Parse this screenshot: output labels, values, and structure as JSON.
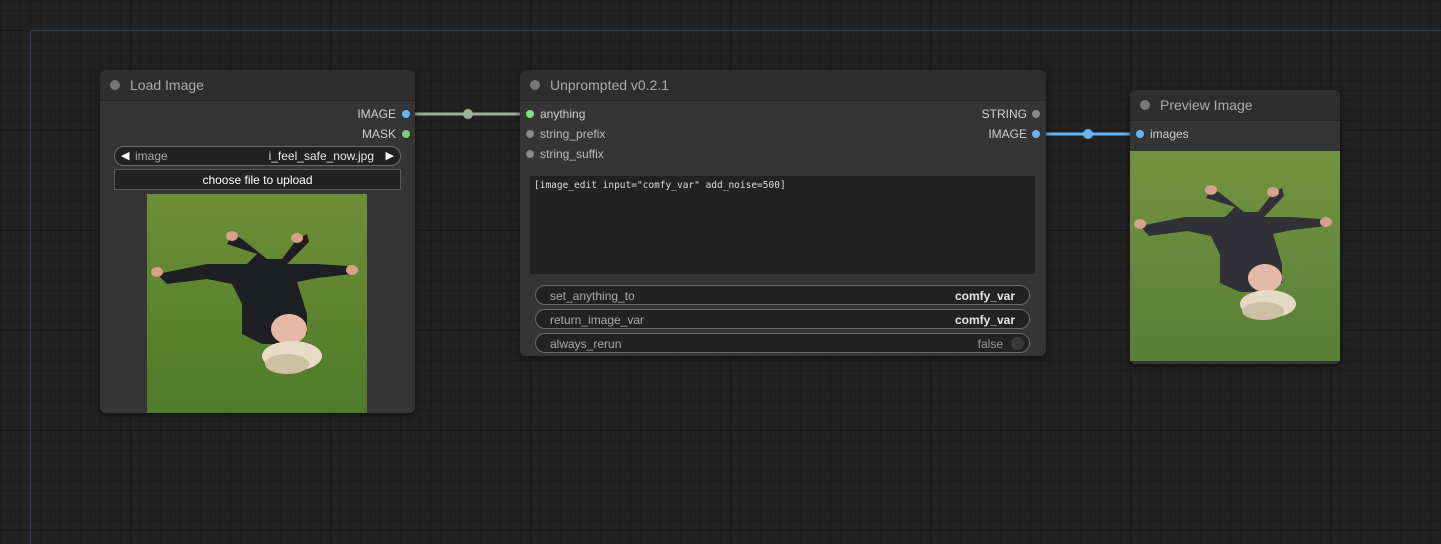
{
  "colors": {
    "image_link": "#64b5f6",
    "mask_link": "#81c784",
    "any_link": "#a0b09a",
    "background": "#222222",
    "node_body": "#353535"
  },
  "load_image": {
    "title": "Load Image",
    "outputs": [
      "IMAGE",
      "MASK"
    ],
    "image_widget": {
      "label": "image",
      "value": "i_feel_safe_now.jpg"
    },
    "upload_button": "choose file to upload",
    "preview": "photo-person-lying-on-grass"
  },
  "unprompted": {
    "title": "Unprompted v0.2.1",
    "inputs": [
      "anything",
      "string_prefix",
      "string_suffix"
    ],
    "outputs": [
      "STRING",
      "IMAGE"
    ],
    "text": "[image_edit input=\"comfy_var\" add_noise=500]",
    "widgets": [
      {
        "label": "set_anything_to",
        "value": "comfy_var"
      },
      {
        "label": "return_image_var",
        "value": "comfy_var"
      }
    ],
    "toggle": {
      "label": "always_rerun",
      "value": "false"
    }
  },
  "preview_image": {
    "title": "Preview Image",
    "inputs": [
      "images"
    ],
    "preview": "photo-person-lying-on-grass-noisy"
  }
}
